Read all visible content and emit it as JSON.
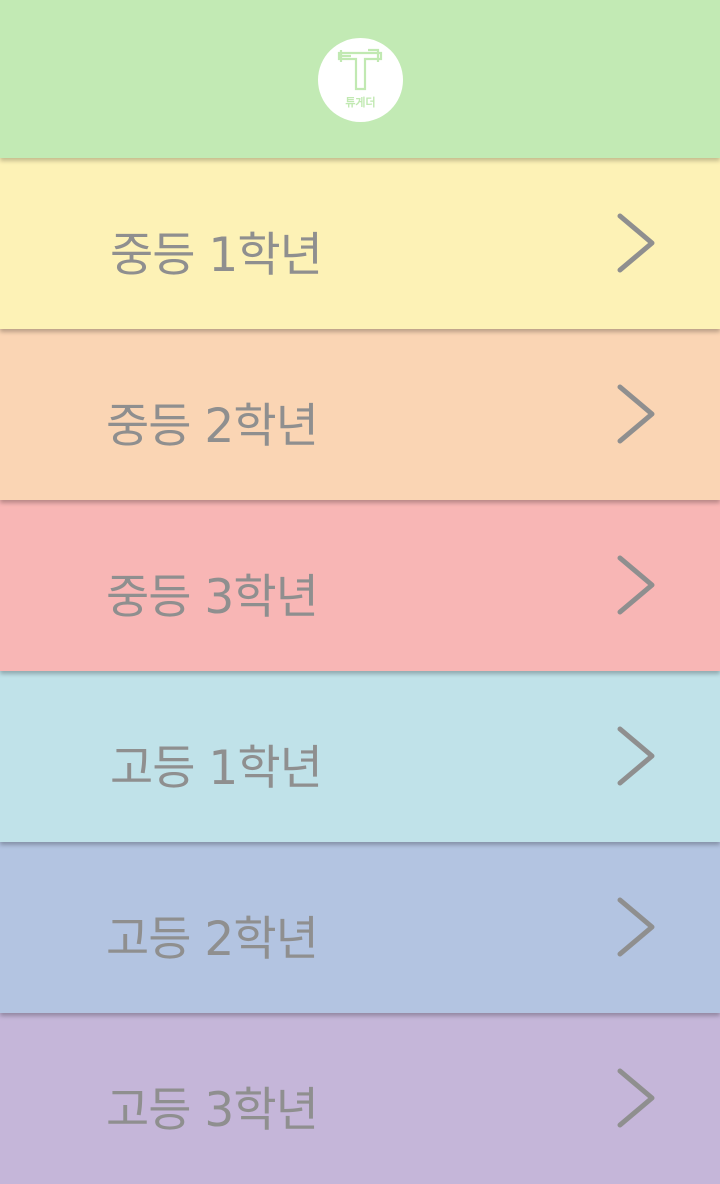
{
  "header": {
    "logo": {
      "text": "튜게더",
      "icon": "t-logo-icon",
      "color": "#c1e9b2"
    },
    "background": "#c2eab4"
  },
  "grades": [
    {
      "label": "중등 1학년",
      "color": "#fdf2b6",
      "icon": "chevron-right-icon"
    },
    {
      "label": "중등 2학년",
      "color": "#fad5b4",
      "icon": "chevron-right-icon"
    },
    {
      "label": "중등 3학년",
      "color": "#f8b6b5",
      "icon": "chevron-right-icon"
    },
    {
      "label": "고등 1학년",
      "color": "#c0e2e9",
      "icon": "chevron-right-icon"
    },
    {
      "label": "고등 2학년",
      "color": "#b3c4e1",
      "icon": "chevron-right-icon"
    },
    {
      "label": "고등 3학년",
      "color": "#c5b6d9",
      "icon": "chevron-right-icon"
    }
  ],
  "text_color": "#8f8f8f"
}
